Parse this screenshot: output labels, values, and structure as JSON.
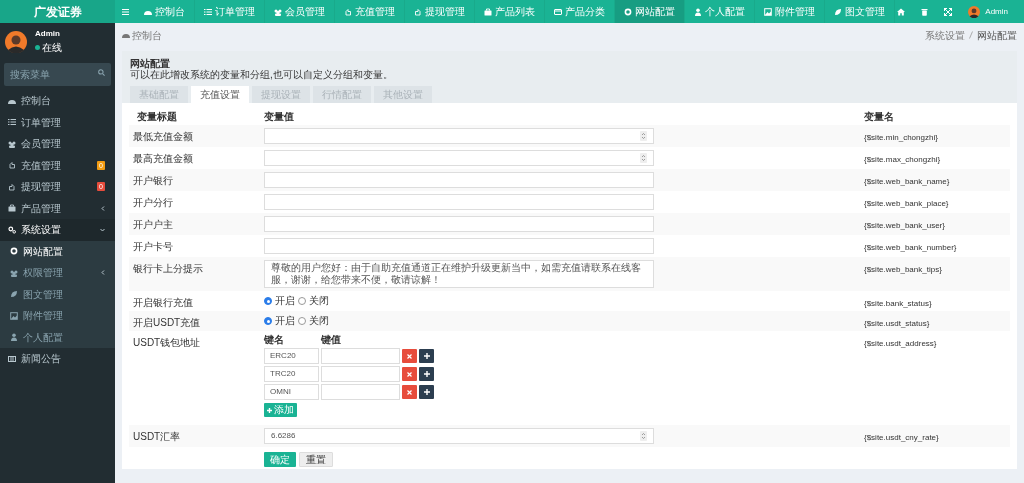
{
  "brand": "广发证券",
  "top_nav": [
    {
      "label": "控制台",
      "selected": false
    },
    {
      "label": "订单管理",
      "selected": false
    },
    {
      "label": "会员管理",
      "selected": false
    },
    {
      "label": "充值管理",
      "selected": false
    },
    {
      "label": "提现管理",
      "selected": false
    },
    {
      "label": "产品列表",
      "selected": false
    },
    {
      "label": "产品分类",
      "selected": false
    },
    {
      "label": "网站配置",
      "selected": true
    },
    {
      "label": "个人配置",
      "selected": false
    },
    {
      "label": "附件管理",
      "selected": false
    },
    {
      "label": "图文管理",
      "selected": false
    }
  ],
  "top_user": "Admin",
  "user": {
    "name": "Admin",
    "status": "在线"
  },
  "search": {
    "placeholder": "搜索菜单"
  },
  "sidebar": {
    "items": [
      {
        "label": "控制台",
        "selected": false
      },
      {
        "label": "订单管理",
        "selected": false
      },
      {
        "label": "会员管理",
        "selected": false
      },
      {
        "label": "充值管理",
        "selected": false,
        "badge": "0",
        "color": "#f39c12"
      },
      {
        "label": "提现管理",
        "selected": false,
        "badge": "0",
        "color": "#e74c3c"
      },
      {
        "label": "产品管理",
        "selected": false,
        "expanded": false
      },
      {
        "label": "系统设置",
        "selected": false,
        "expanded": true,
        "children": [
          {
            "label": "网站配置",
            "selected": true
          },
          {
            "label": "权限管理",
            "selected": false,
            "expanded": false
          },
          {
            "label": "图文管理",
            "selected": false
          },
          {
            "label": "附件管理",
            "selected": false
          },
          {
            "label": "个人配置",
            "selected": false
          }
        ]
      },
      {
        "label": "新闻公告",
        "selected": false
      }
    ]
  },
  "breadcrumb_home": "控制台",
  "breadcrumb": [
    "系统设置",
    "网站配置"
  ],
  "panel": {
    "title": "网站配置",
    "description": "可以在此增改系统的变量和分组,也可以自定义分组和变量。",
    "tabs": [
      {
        "label": "基础配置",
        "selected": false
      },
      {
        "label": "充值设置",
        "selected": true
      },
      {
        "label": "提现设置",
        "selected": false
      },
      {
        "label": "行情配置",
        "selected": false
      },
      {
        "label": "其他设置",
        "selected": false
      }
    ]
  },
  "table": {
    "columns": [
      "变量标题",
      "变量值",
      "变量名"
    ],
    "rows": [
      {
        "kind": "number",
        "title": "最低充值金额",
        "variable": "{$site.min_chongzhi}"
      },
      {
        "kind": "number",
        "title": "最高充值金额",
        "variable": "{$site.max_chongzhi}"
      },
      {
        "kind": "text",
        "title": "开户银行",
        "variable": "{$site.web_bank_name}"
      },
      {
        "kind": "text",
        "title": "开户分行",
        "variable": "{$site.web_bank_place}"
      },
      {
        "kind": "text",
        "title": "开户户主",
        "variable": "{$site.web_bank_user}"
      },
      {
        "kind": "text",
        "title": "开户卡号",
        "variable": "{$site.web_bank_number}"
      },
      {
        "kind": "textarea",
        "title": "银行卡上分提示",
        "value": "尊敬的用户您好：由于自助充值通道正在维护升级更新当中，如需充值请联系在线客服，谢谢，给您带来不便，敬请谅解！",
        "variable": "{$site.web_bank_tips}"
      },
      {
        "kind": "radio",
        "title": "开启银行充值",
        "options": [
          {
            "label": "开启",
            "selected": true
          },
          {
            "label": "关闭",
            "selected": false
          }
        ],
        "variable": "{$site.bank_status}"
      },
      {
        "kind": "radio",
        "title": "开启USDT充值",
        "options": [
          {
            "label": "开启",
            "selected": true
          },
          {
            "label": "关闭",
            "selected": false
          }
        ],
        "variable": "{$site.usdt_status}"
      },
      {
        "kind": "keyvalue",
        "title": "USDT钱包地址",
        "key_header": "键名",
        "value_header": "键值",
        "entries": [
          {
            "key": "ERC20"
          },
          {
            "key": "TRC20"
          },
          {
            "key": "OMNI"
          }
        ],
        "add_label": "添加",
        "variable": "{$site.usdt_address}"
      },
      {
        "kind": "number",
        "title": "USDT汇率",
        "value": "6.6286",
        "variable": "{$site.usdt_cny_rate}"
      }
    ]
  },
  "buttons": [
    {
      "label": "确定",
      "kind": "primary"
    },
    {
      "label": "重置",
      "kind": "default"
    }
  ]
}
